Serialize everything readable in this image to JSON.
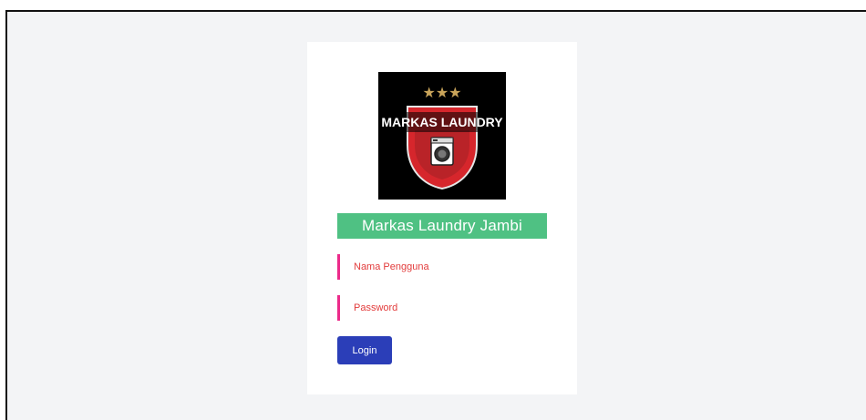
{
  "logo": {
    "text": "MARKAS LAUNDRY",
    "stars": "★★★",
    "icon": "washing-machine-icon",
    "colors": {
      "background": "#000000",
      "shield": "#d6262c",
      "stars": "#c9a45a",
      "text": "#ffffff"
    }
  },
  "brand": {
    "name": "Markas Laundry Jambi",
    "color": "#4fc183"
  },
  "form": {
    "username_placeholder": "Nama Pengguna",
    "password_placeholder": "Password",
    "login_label": "Login",
    "accent": "#ec2a8a",
    "button_color": "#2b3eb8"
  }
}
